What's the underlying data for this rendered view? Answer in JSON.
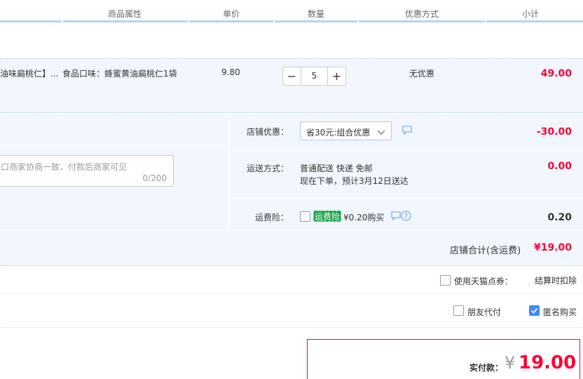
{
  "header": {
    "columns": [
      "商品属性",
      "单价",
      "数量",
      "优惠方式",
      "小计"
    ]
  },
  "item": {
    "title_fragment": "油味扁桃仁】...",
    "attribute": "食品口味：蜂蜜黄油扁桃仁1袋",
    "unit_price": "9.80",
    "quantity": "5",
    "minus_label": "−",
    "plus_label": "+",
    "discount_method": "无优惠",
    "subtotal": "49.00"
  },
  "order": {
    "message_placeholder": "口商家协商一致，付款后商家可见",
    "message_counter": "0/200",
    "shop_discount": {
      "label": "店铺优惠：",
      "selected": "省30元:组合优惠",
      "amount": "-30.00"
    },
    "delivery": {
      "label": "运送方式：",
      "method": "普通配送 快递 免邮",
      "eta": "现在下单，预计3月12日送达",
      "amount": "0.00"
    },
    "freight_insurance": {
      "label": "运费险：",
      "tag": "运费险",
      "price_text": "¥0.20购买",
      "amount": "0.20"
    },
    "total": {
      "label": "店铺合计(含运费)",
      "value": "¥19.00"
    }
  },
  "options": {
    "tmall_coupon_label": "使用天猫点券：",
    "tmall_coupon_note": "结算时扣除",
    "friend_pay_label": "朋友代付",
    "anonymous_label": "匿名购买"
  },
  "payment": {
    "label": "实付款：",
    "currency": "¥",
    "amount": "19.00"
  },
  "colors": {
    "accent_red": "#ff0036",
    "panel_bg": "#f2f7ff",
    "header_rule": "#b2d1ff",
    "checkbox_blue": "#3b8cfe"
  }
}
